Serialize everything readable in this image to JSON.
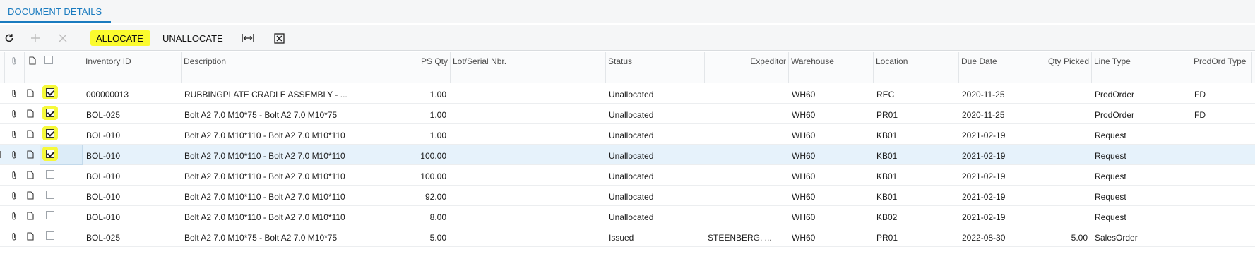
{
  "tab": {
    "label": "DOCUMENT DETAILS"
  },
  "toolbar": {
    "refresh_icon": "refresh-icon",
    "add_icon": "plus-icon",
    "delete_icon": "close-icon",
    "allocate_label": "ALLOCATE",
    "unallocate_label": "UNALLOCATE",
    "fit_icon": "fit-columns-icon",
    "excel_icon": "excel-export-icon",
    "highlight_color": "#fbfb2e"
  },
  "columns": {
    "inventory_id": "Inventory ID",
    "description": "Description",
    "ps_qty": "PS Qty",
    "lot_serial": "Lot/Serial Nbr.",
    "status": "Status",
    "expeditor": "Expeditor",
    "warehouse": "Warehouse",
    "location": "Location",
    "due_date": "Due Date",
    "qty_picked": "Qty Picked",
    "line_type": "Line Type",
    "prodord_type": "ProdOrd Type"
  },
  "rows": [
    {
      "checked": true,
      "highlighted": true,
      "inventory_id": "000000013",
      "description": "RUBBINGPLATE CRADLE ASSEMBLY - ...",
      "ps_qty": "1.00",
      "lot_serial": "",
      "status": "Unallocated",
      "expeditor": "",
      "warehouse": "WH60",
      "location": "REC",
      "due_date": "2020-11-25",
      "qty_picked": "",
      "line_type": "ProdOrder",
      "prodord_type": "FD"
    },
    {
      "checked": true,
      "highlighted": true,
      "inventory_id": "BOL-025",
      "description": "Bolt A2 7.0 M10*75 - Bolt A2 7.0 M10*75",
      "ps_qty": "1.00",
      "lot_serial": "",
      "status": "Unallocated",
      "expeditor": "",
      "warehouse": "WH60",
      "location": "PR01",
      "due_date": "2020-11-25",
      "qty_picked": "",
      "line_type": "ProdOrder",
      "prodord_type": "FD"
    },
    {
      "checked": true,
      "highlighted": true,
      "inventory_id": "BOL-010",
      "description": "Bolt A2 7.0 M10*110 - Bolt A2 7.0 M10*110",
      "ps_qty": "1.00",
      "lot_serial": "",
      "status": "Unallocated",
      "expeditor": "",
      "warehouse": "WH60",
      "location": "KB01",
      "due_date": "2021-02-19",
      "qty_picked": "",
      "line_type": "Request",
      "prodord_type": ""
    },
    {
      "checked": true,
      "highlighted": true,
      "inventory_id": "BOL-010",
      "description": "Bolt A2 7.0 M10*110 - Bolt A2 7.0 M10*110",
      "ps_qty": "100.00",
      "lot_serial": "",
      "status": "Unallocated",
      "expeditor": "",
      "warehouse": "WH60",
      "location": "KB01",
      "due_date": "2021-02-19",
      "qty_picked": "",
      "line_type": "Request",
      "prodord_type": ""
    },
    {
      "checked": false,
      "highlighted": false,
      "inventory_id": "BOL-010",
      "description": "Bolt A2 7.0 M10*110 - Bolt A2 7.0 M10*110",
      "ps_qty": "100.00",
      "lot_serial": "",
      "status": "Unallocated",
      "expeditor": "",
      "warehouse": "WH60",
      "location": "KB01",
      "due_date": "2021-02-19",
      "qty_picked": "",
      "line_type": "Request",
      "prodord_type": ""
    },
    {
      "checked": false,
      "highlighted": false,
      "inventory_id": "BOL-010",
      "description": "Bolt A2 7.0 M10*110 - Bolt A2 7.0 M10*110",
      "ps_qty": "92.00",
      "lot_serial": "",
      "status": "Unallocated",
      "expeditor": "",
      "warehouse": "WH60",
      "location": "KB01",
      "due_date": "2021-02-19",
      "qty_picked": "",
      "line_type": "Request",
      "prodord_type": ""
    },
    {
      "checked": false,
      "highlighted": false,
      "inventory_id": "BOL-010",
      "description": "Bolt A2 7.0 M10*110 - Bolt A2 7.0 M10*110",
      "ps_qty": "8.00",
      "lot_serial": "",
      "status": "Unallocated",
      "expeditor": "",
      "warehouse": "WH60",
      "location": "KB02",
      "due_date": "2021-02-19",
      "qty_picked": "",
      "line_type": "Request",
      "prodord_type": ""
    },
    {
      "checked": false,
      "highlighted": false,
      "inventory_id": "BOL-025",
      "description": "Bolt A2 7.0 M10*75 - Bolt A2 7.0 M10*75",
      "ps_qty": "5.00",
      "lot_serial": "",
      "status": "Issued",
      "expeditor": "STEENBERG, ...",
      "warehouse": "WH60",
      "location": "PR01",
      "due_date": "2022-08-30",
      "qty_picked": "5.00",
      "line_type": "SalesOrder",
      "prodord_type": ""
    }
  ],
  "selected_row": 3
}
